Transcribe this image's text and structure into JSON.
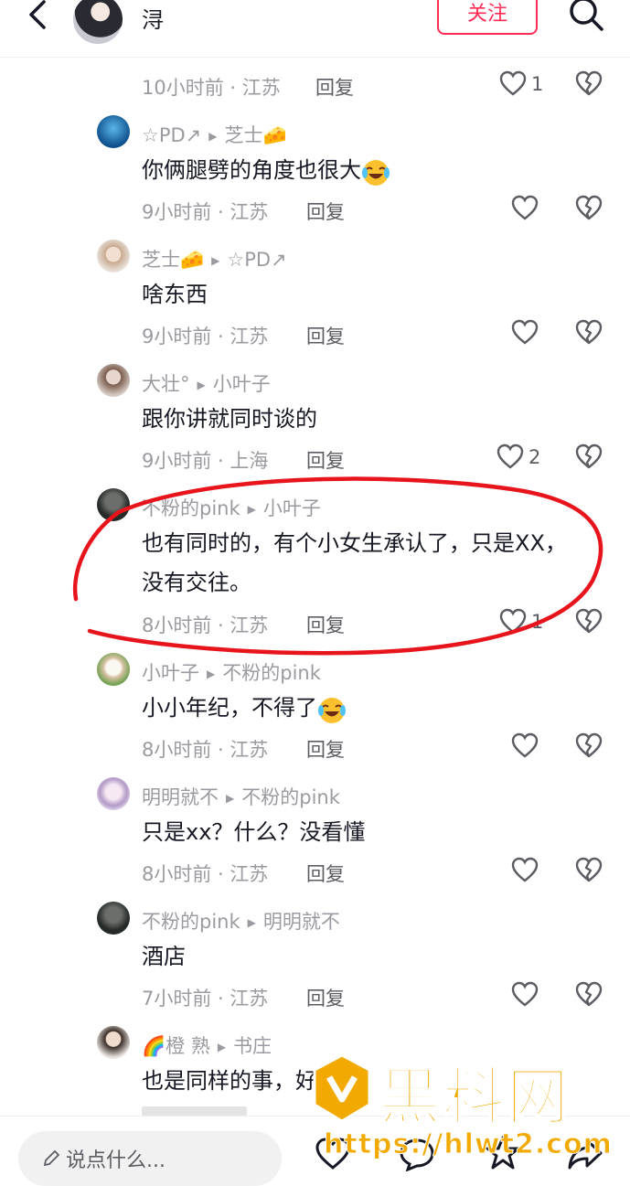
{
  "header": {
    "user_name": "浔",
    "follow_label": "关注"
  },
  "comments": [
    {
      "meta": "10小时前 · 江苏",
      "reply": "回复",
      "likes": "1",
      "partial": true
    },
    {
      "author": "☆PD↗",
      "reply_to": "芝士🧀",
      "text": "你俩腿劈的角度也很大",
      "meta": "9小时前 · 江苏",
      "reply": "回复",
      "likes": ""
    },
    {
      "author": "芝士🧀",
      "reply_to": "☆PD↗",
      "text": "啥东西",
      "meta": "9小时前 · 江苏",
      "reply": "回复",
      "likes": ""
    },
    {
      "author": "大壮°",
      "reply_to": "小叶子",
      "text": "跟你讲就同时谈的",
      "meta": "9小时前 · 上海",
      "reply": "回复",
      "likes": "2"
    },
    {
      "author": "不粉的pink",
      "reply_to": "小叶子",
      "text": "也有同时的，有个小女生承认了，只是XX，",
      "text2": "没有交往。",
      "meta": "8小时前 · 江苏",
      "reply": "回复",
      "likes": "1"
    },
    {
      "author": "小叶子",
      "reply_to": "不粉的pink",
      "text": "小小年纪，不得了",
      "meta": "8小时前 · 江苏",
      "reply": "回复",
      "likes": ""
    },
    {
      "author": "明明就不",
      "reply_to": "不粉的pink",
      "text": "只是xx？什么？没看懂",
      "meta": "8小时前 · 江苏",
      "reply": "回复",
      "likes": ""
    },
    {
      "author": "不粉的pink",
      "reply_to": "明明就不",
      "text": "酒店",
      "meta": "7小时前 · 江苏",
      "reply": "回复",
      "likes": ""
    },
    {
      "author": "🌈橙 熟",
      "reply_to": "书庄",
      "text": "也是同样的事，好几个",
      "partial": true
    }
  ],
  "bottom_bar": {
    "input_placeholder": "说点什么..."
  },
  "watermark": {
    "brand": "黑料网",
    "url": "https://hlwt2.com"
  },
  "colors": {
    "accent": "#fe2c55",
    "highlight_circle": "#e8141c",
    "watermark": "#f2a900"
  }
}
